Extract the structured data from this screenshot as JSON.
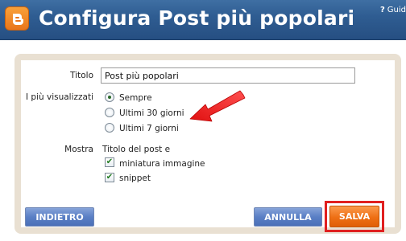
{
  "header": {
    "title": "Configura Post più popolari",
    "help_icon": "question-icon",
    "help_label": "Guid"
  },
  "form": {
    "title_label": "Titolo",
    "title_value": "Post più popolari",
    "most_viewed_label": "I più visualizzati",
    "options": [
      "Sempre",
      "Ultimi 30 giorni",
      "Ultimi 7 giorni"
    ],
    "selected_option": "Sempre",
    "show_label": "Mostra",
    "show_text": "Titolo del post e",
    "checkboxes": [
      {
        "label": "miniatura immagine",
        "checked": true
      },
      {
        "label": "snippet",
        "checked": true
      }
    ]
  },
  "buttons": {
    "back": "INDIETRO",
    "cancel": "ANNULLA",
    "save": "SALVA"
  },
  "colors": {
    "header_bg": "#2f5d92",
    "panel_border": "#e9e0d2",
    "annotation": "#e02020",
    "save_button": "#ee6f14",
    "button_blue": "#5a7fc5"
  }
}
